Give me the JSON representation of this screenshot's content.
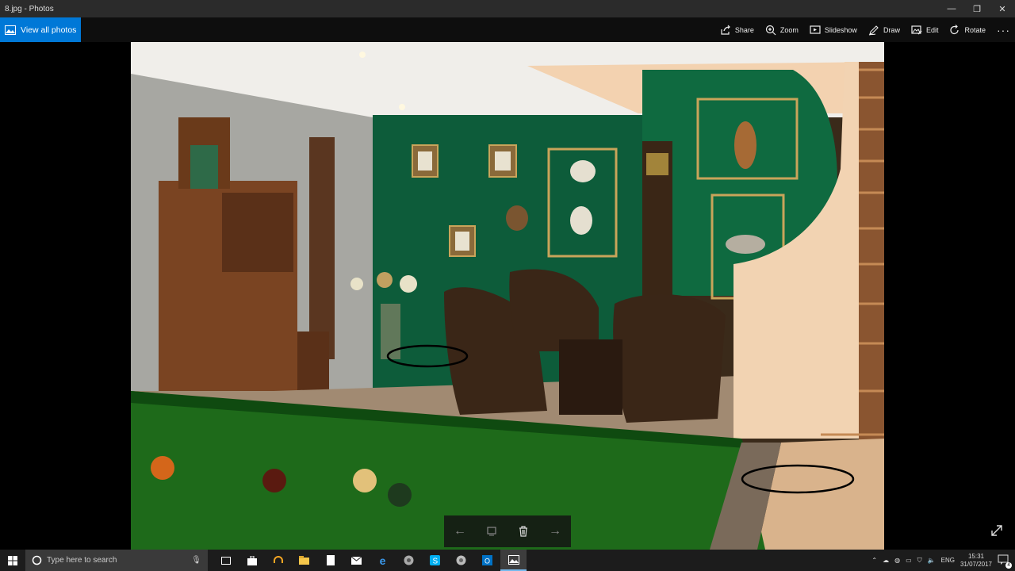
{
  "window": {
    "title": "8.jpg - Photos",
    "controls": [
      "minimize",
      "restore",
      "close"
    ]
  },
  "toolbar": {
    "view_all_label": "View all photos",
    "items": [
      {
        "label": "Share",
        "icon": "share-icon"
      },
      {
        "label": "Zoom",
        "icon": "zoom-icon"
      },
      {
        "label": "Slideshow",
        "icon": "slideshow-icon"
      },
      {
        "label": "Draw",
        "icon": "draw-icon"
      },
      {
        "label": "Edit",
        "icon": "edit-icon"
      },
      {
        "label": "Rotate",
        "icon": "rotate-icon"
      }
    ],
    "more": "···"
  },
  "photo": {
    "description_icon": "billiard-room-photo"
  },
  "navbar": {
    "buttons": [
      "previous-arrow-icon",
      "info-icon",
      "delete-icon",
      "next-arrow-icon"
    ]
  },
  "taskbar": {
    "search_placeholder": "Type here to search",
    "apps": [
      "task-view-icon",
      "store-icon",
      "headphones-icon",
      "file-explorer-icon",
      "notepad-icon",
      "mail-icon",
      "edge-icon",
      "chrome-icon",
      "skype-icon",
      "chrome-canary-icon",
      "outlook-icon",
      "photos-icon"
    ],
    "tray": {
      "language": "ENG",
      "time": "15:31",
      "date": "31/07/2017",
      "notification_count": "4"
    }
  },
  "colors": {
    "accent": "#0078d7",
    "taskbar": "#1c1c1c",
    "green_wall": "#0d5c3a"
  }
}
